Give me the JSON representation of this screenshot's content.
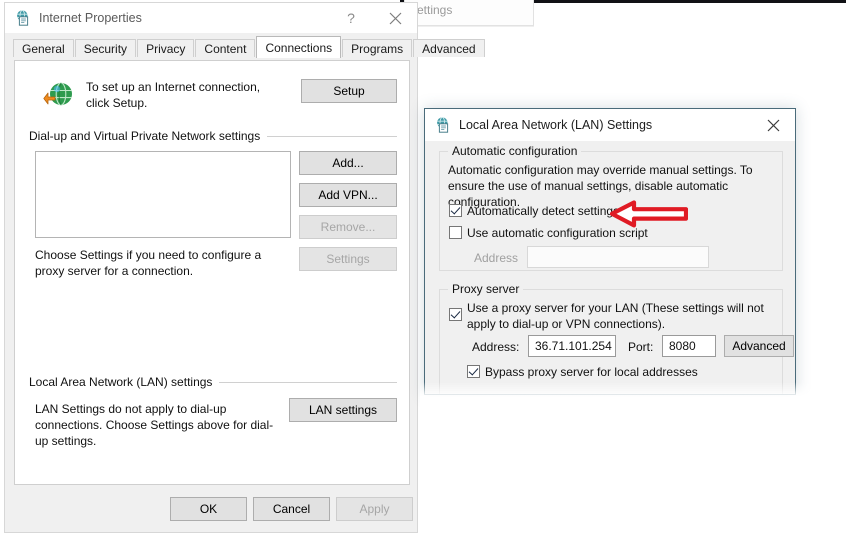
{
  "background": {
    "ghost_field_text": "settings"
  },
  "internet_properties": {
    "title": "Internet Properties",
    "titlebar": {
      "icon": "internet-properties-icon",
      "help_label": "?",
      "close_label": "close-icon"
    },
    "tabs": [
      {
        "label": "General",
        "active": false
      },
      {
        "label": "Security",
        "active": false
      },
      {
        "label": "Privacy",
        "active": false
      },
      {
        "label": "Content",
        "active": false
      },
      {
        "label": "Connections",
        "active": true
      },
      {
        "label": "Programs",
        "active": false
      },
      {
        "label": "Advanced",
        "active": false
      }
    ],
    "setup": {
      "icon": "globe-with-arrow-icon",
      "text": "To set up an Internet connection, click Setup.",
      "button_label": "Setup"
    },
    "dialup_group": {
      "label": "Dial-up and Virtual Private Network settings",
      "list_items": [],
      "buttons": [
        {
          "label": "Add...",
          "enabled": true
        },
        {
          "label": "Add VPN...",
          "enabled": true
        },
        {
          "label": "Remove...",
          "enabled": false
        },
        {
          "label": "Settings",
          "enabled": false
        }
      ],
      "hint": "Choose Settings if you need to configure a proxy server for a connection."
    },
    "lan_group": {
      "label": "Local Area Network (LAN) settings",
      "hint": "LAN Settings do not apply to dial-up connections. Choose Settings above for dial-up settings.",
      "button_label": "LAN settings"
    },
    "commands": [
      {
        "label": "OK",
        "enabled": true
      },
      {
        "label": "Cancel",
        "enabled": true
      },
      {
        "label": "Apply",
        "enabled": false
      }
    ]
  },
  "lan_settings": {
    "title": "Local Area Network (LAN) Settings",
    "titlebar": {
      "icon": "lan-settings-icon",
      "close_label": "close-icon"
    },
    "automatic_configuration": {
      "group_label": "Automatic configuration",
      "description": "Automatic configuration may override manual settings.  To ensure the use of manual settings, disable automatic configuration.",
      "auto_detect": {
        "label": "Automatically detect settings",
        "checked": true
      },
      "auto_script": {
        "label": "Use automatic configuration script",
        "checked": false
      },
      "address_label": "Address",
      "address_value": "",
      "address_enabled": false
    },
    "proxy_server": {
      "group_label": "Proxy server",
      "use_proxy": {
        "label": "Use a proxy server for your LAN (These settings will not apply to dial-up or VPN connections).",
        "checked": true
      },
      "address_label": "Address:",
      "address_value": "36.71.101.254",
      "port_label": "Port:",
      "port_value": "8080",
      "advanced_label": "Advanced",
      "bypass": {
        "label": "Bypass proxy server for local addresses",
        "checked": true
      }
    }
  },
  "annotation": {
    "arrow": {
      "name": "red-left-arrow",
      "color": "#e01b24",
      "direction": "left",
      "points_at": "Automatically detect settings"
    }
  }
}
